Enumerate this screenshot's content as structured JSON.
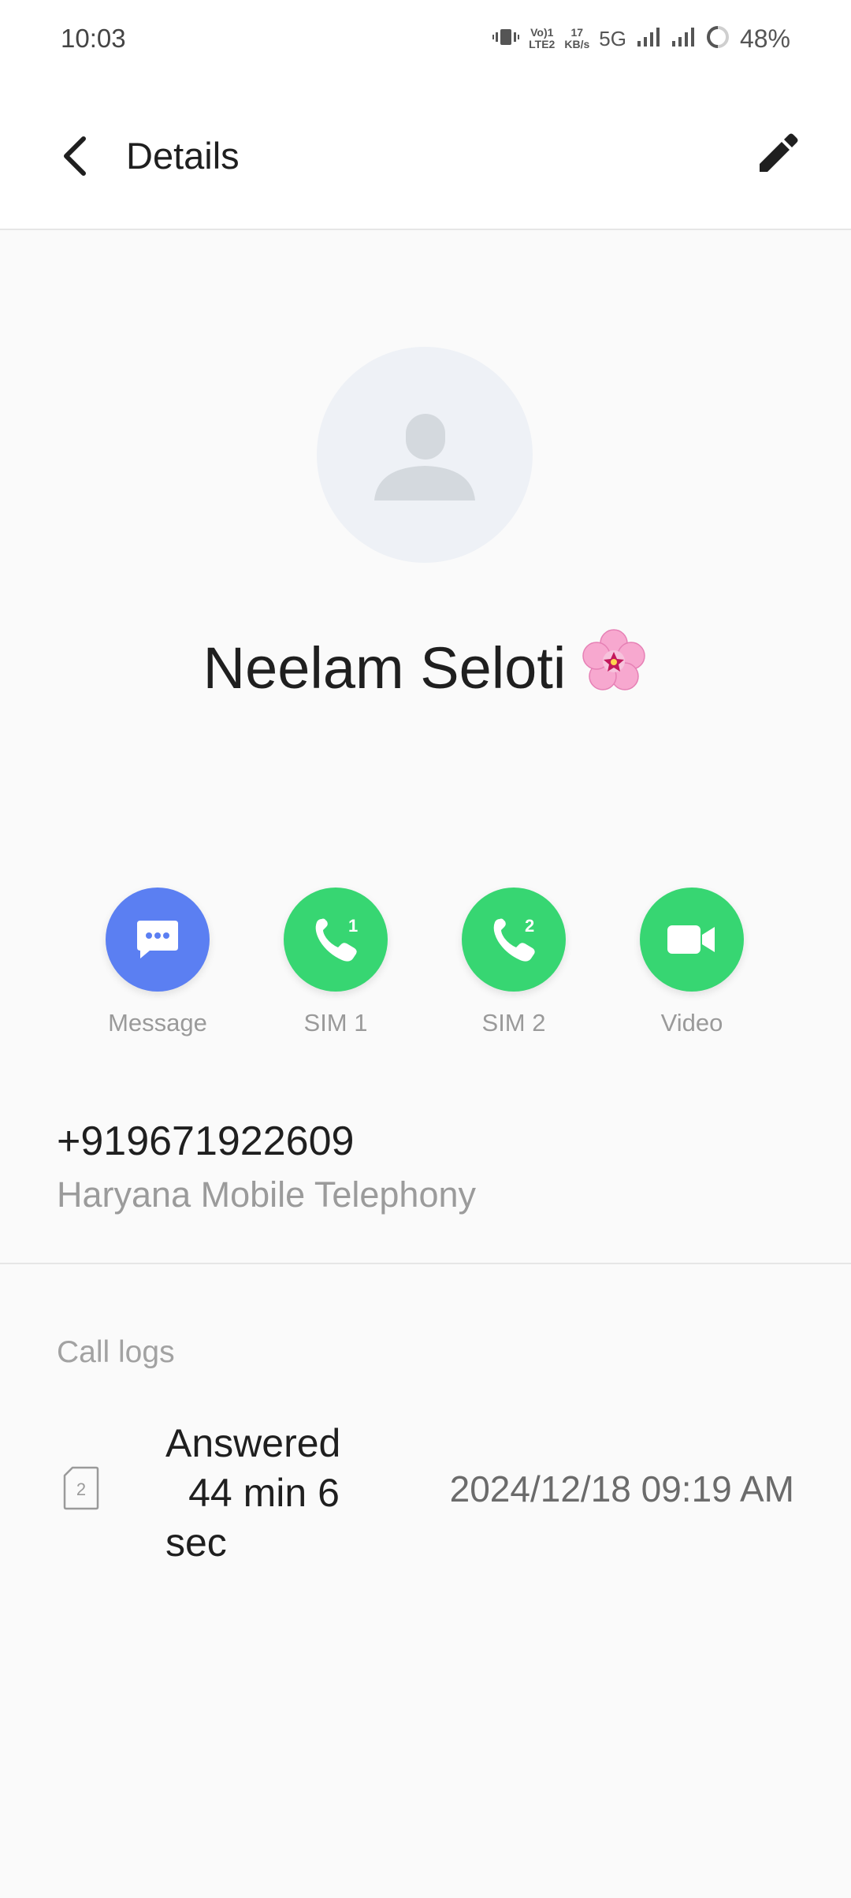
{
  "status_bar": {
    "time": "10:03",
    "volte": "Vo) 1\nLTE2",
    "speed_value": "17",
    "speed_unit": "KB/s",
    "network": "5G",
    "battery": "48%"
  },
  "header": {
    "title": "Details",
    "back_icon": "chevron-left-icon",
    "edit_icon": "pencil-icon"
  },
  "contact": {
    "name": "Neelam Seloti",
    "emoji": "🌸",
    "phone": "+919671922609",
    "carrier": "Haryana Mobile Telephony"
  },
  "actions": [
    {
      "label": "Message",
      "icon": "message-icon",
      "color": "#5b7ff2"
    },
    {
      "label": "SIM 1",
      "icon": "phone-sim1-icon",
      "badge": "1",
      "color": "#37d672"
    },
    {
      "label": "SIM 2",
      "icon": "phone-sim2-icon",
      "badge": "2",
      "color": "#37d672"
    },
    {
      "label": "Video",
      "icon": "video-camera-icon",
      "color": "#37d672"
    }
  ],
  "call_logs": {
    "title": "Call logs",
    "entries": [
      {
        "sim": "2",
        "status_line1": "Answered",
        "status_line2": "44 min 6",
        "status_line3": "sec",
        "datetime": "2024/12/18 09:19 AM"
      }
    ]
  }
}
